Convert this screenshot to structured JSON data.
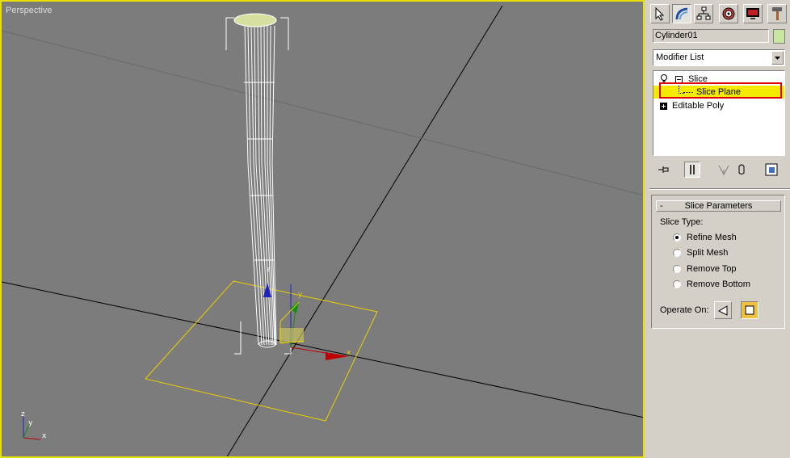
{
  "viewport": {
    "label": "Perspective",
    "active_border_color": "#e8e000",
    "background_color": "#7c7c7c",
    "axis_tripod": {
      "z": "z",
      "y": "y",
      "x": "x"
    },
    "gizmo_axis_labels": {
      "z": "z",
      "y": "y",
      "x": "x"
    }
  },
  "command_panel": {
    "tabs": [
      {
        "name": "create-tab",
        "icon": "create-cursor-icon"
      },
      {
        "name": "modify-tab",
        "icon": "modify-bend-icon",
        "active": true
      },
      {
        "name": "hierarchy-tab",
        "icon": "hierarchy-icon"
      },
      {
        "name": "motion-tab",
        "icon": "motion-wheel-icon"
      },
      {
        "name": "display-tab",
        "icon": "display-monitor-icon"
      },
      {
        "name": "utilities-tab",
        "icon": "hammer-icon"
      }
    ],
    "object_name": "Cylinder01",
    "object_color": "#c8e6a0",
    "modifier_list": {
      "selected": "Modifier List"
    },
    "stack": {
      "slice": "Slice",
      "slice_plane": "Slice Plane",
      "editable_poly": "Editable Poly",
      "highlight_color": "#f4ea00"
    },
    "stack_tools": [
      "pin-stack-icon",
      "show-end-result-icon",
      "make-unique-icon",
      "remove-modifier-icon",
      "configure-sets-icon"
    ],
    "slice_parameters": {
      "title": "Slice Parameters",
      "collapse": "-",
      "slice_type_label": "Slice Type:",
      "options": [
        {
          "label": "Refine Mesh",
          "selected": true
        },
        {
          "label": "Split Mesh",
          "selected": false
        },
        {
          "label": "Remove Top",
          "selected": false
        },
        {
          "label": "Remove Bottom",
          "selected": false
        }
      ],
      "operate_on_label": "Operate On:"
    }
  }
}
